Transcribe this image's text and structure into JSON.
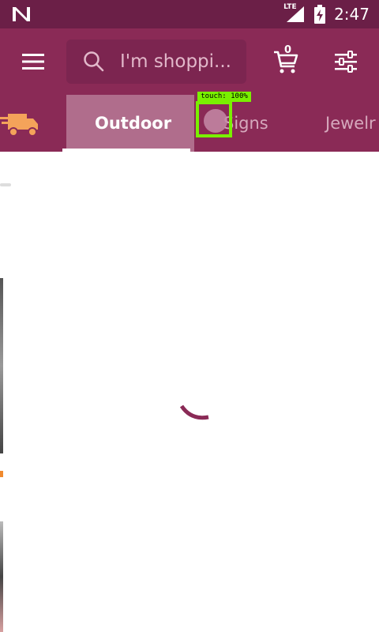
{
  "status_bar": {
    "time": "2:47",
    "network_label": "LTE",
    "icons": [
      "n-logo-icon",
      "signal-icon",
      "battery-charging-icon"
    ]
  },
  "app_bar": {
    "search_placeholder": "I'm shoppi...",
    "cart_count": "0",
    "icons": [
      "hamburger-menu-icon",
      "search-icon",
      "cart-icon",
      "filter-sliders-icon"
    ]
  },
  "tabs": {
    "items": [
      {
        "label": "Outdoor",
        "active": true
      },
      {
        "label": "Signs",
        "active": false
      },
      {
        "label": "Jewelr",
        "active": false
      }
    ],
    "leading_icon": "truck-icon"
  },
  "overlay": {
    "touch_label": "touch: 100%"
  },
  "content": {
    "state": "loading"
  },
  "colors": {
    "status_bar": "#6b1f47",
    "app_bar": "#8a2a56",
    "active_tab": "#b06d8c",
    "touch_box": "#79f000",
    "spinner": "#8a2a56"
  }
}
